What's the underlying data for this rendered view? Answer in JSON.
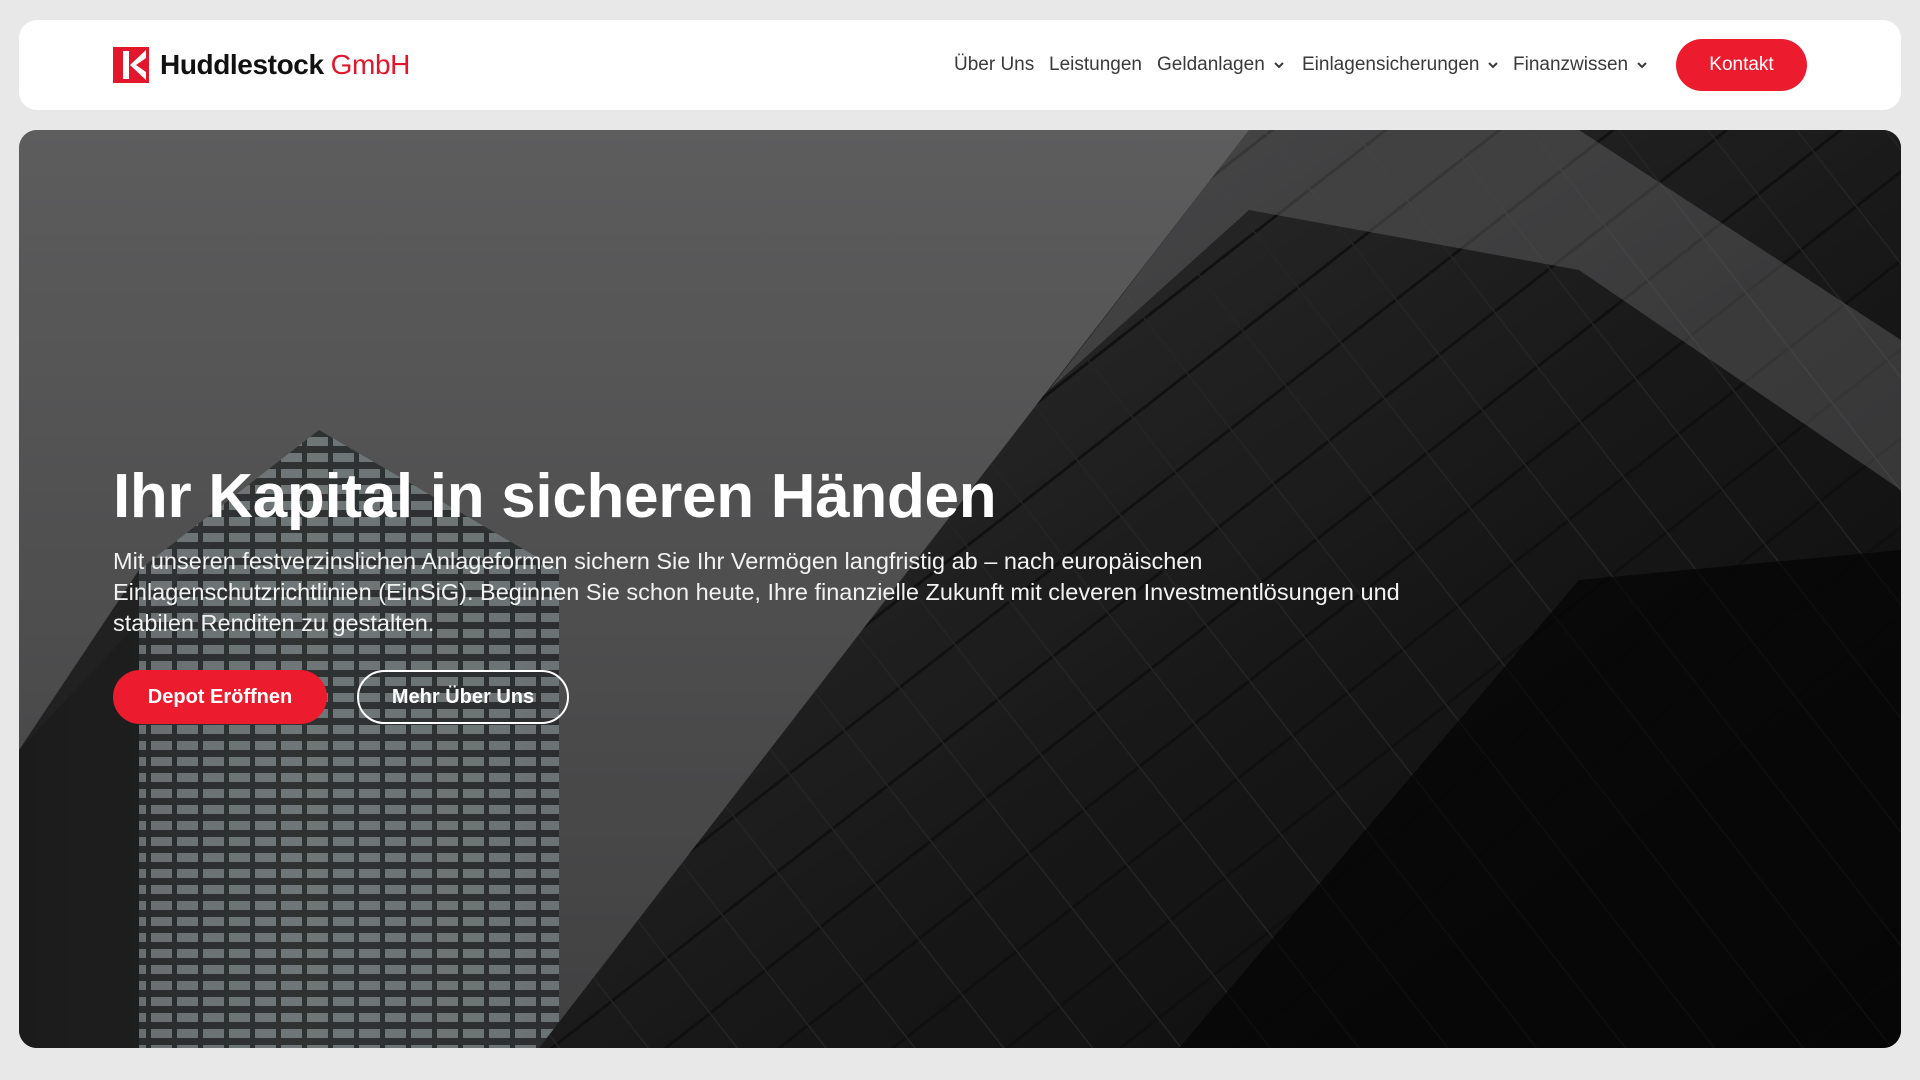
{
  "header": {
    "brand": {
      "name": "Huddlestock",
      "suffix": "GmbH"
    },
    "nav": [
      {
        "label": "Über Uns",
        "has_dropdown": false
      },
      {
        "label": "Leistungen",
        "has_dropdown": false
      },
      {
        "label": "Geldanlagen",
        "has_dropdown": true
      },
      {
        "label": "Einlagensicherungen",
        "has_dropdown": true
      },
      {
        "label": "Finanzwissen",
        "has_dropdown": true
      }
    ],
    "contact_label": "Kontakt"
  },
  "hero": {
    "title": "Ihr Kapital in sicheren Händen",
    "text": "Mit unseren festverzinslichen Anlageformen sichern Sie Ihr Vermögen langfristig ab – nach europäischen Einlagenschutzrichtlinien (EinSiG). Beginnen Sie schon heute, Ihre finanzielle Zukunft mit cleveren Investmentlösungen und stabilen Renditen zu gestalten.",
    "primary_button": "Depot Eröffnen",
    "secondary_button": "Mehr Über Uns"
  },
  "colors": {
    "accent": "#ec1b2e",
    "page_background": "#e8e8e8",
    "header_background": "#ffffff",
    "nav_text": "#3a3a3a"
  },
  "icons": [
    "huddlestock-logo-icon",
    "chevron-down-icon"
  ]
}
